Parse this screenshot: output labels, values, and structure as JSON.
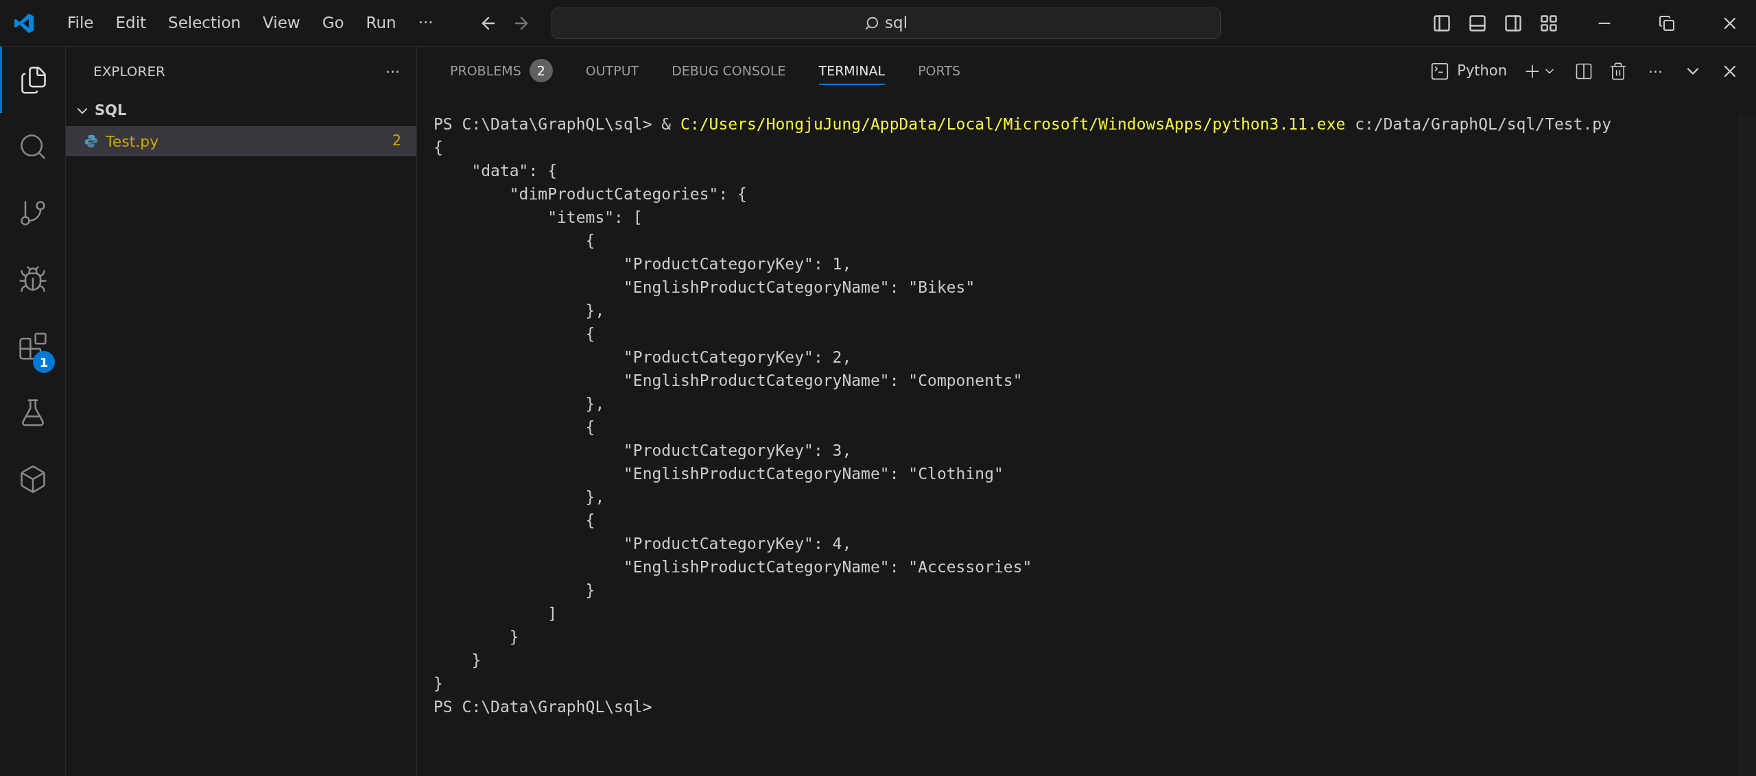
{
  "menu": [
    "File",
    "Edit",
    "Selection",
    "View",
    "Go",
    "Run",
    "···"
  ],
  "search": {
    "value": "sql"
  },
  "activity_bar": [
    {
      "kind": "explorer",
      "selected": true
    },
    {
      "kind": "search",
      "selected": false
    },
    {
      "kind": "source-control",
      "selected": false
    },
    {
      "kind": "run-debug",
      "selected": false
    },
    {
      "kind": "extensions",
      "selected": false,
      "badge": "1"
    },
    {
      "kind": "testing",
      "selected": false
    },
    {
      "kind": "cube",
      "selected": false
    }
  ],
  "sidebar": {
    "title": "EXPLORER",
    "more": "···",
    "folder": {
      "name": "SQL",
      "expanded": true,
      "children": [
        {
          "name": "Test.py",
          "badge": "2",
          "selected": true
        }
      ]
    }
  },
  "panel": {
    "tabs": [
      {
        "label": "PROBLEMS",
        "badge": "2",
        "selected": false
      },
      {
        "label": "OUTPUT",
        "selected": false
      },
      {
        "label": "DEBUG CONSOLE",
        "selected": false
      },
      {
        "label": "TERMINAL",
        "selected": true
      },
      {
        "label": "PORTS",
        "selected": false
      }
    ],
    "terminal_name": "Python",
    "more": "···",
    "lines": [
      [
        {
          "text": "PS C:\\Data\\GraphQL\\sql> & ",
          "kind": "plain"
        },
        {
          "text": "C:/Users/HongjuJung/AppData/Local/Microsoft/WindowsApps/python3.11.exe",
          "kind": "highlight"
        },
        {
          "text": " c:/Data/GraphQL/sql/Test.py",
          "kind": "plain"
        }
      ],
      [
        {
          "text": "{",
          "kind": "plain"
        }
      ],
      [
        {
          "text": "    \"data\": {",
          "kind": "plain"
        }
      ],
      [
        {
          "text": "        \"dimProductCategories\": {",
          "kind": "plain"
        }
      ],
      [
        {
          "text": "            \"items\": [",
          "kind": "plain"
        }
      ],
      [
        {
          "text": "                {",
          "kind": "plain"
        }
      ],
      [
        {
          "text": "                    \"ProductCategoryKey\": 1,",
          "kind": "plain"
        }
      ],
      [
        {
          "text": "                    \"EnglishProductCategoryName\": \"Bikes\"",
          "kind": "plain"
        }
      ],
      [
        {
          "text": "                },",
          "kind": "plain"
        }
      ],
      [
        {
          "text": "                {",
          "kind": "plain"
        }
      ],
      [
        {
          "text": "                    \"ProductCategoryKey\": 2,",
          "kind": "plain"
        }
      ],
      [
        {
          "text": "                    \"EnglishProductCategoryName\": \"Components\"",
          "kind": "plain"
        }
      ],
      [
        {
          "text": "                },",
          "kind": "plain"
        }
      ],
      [
        {
          "text": "                {",
          "kind": "plain"
        }
      ],
      [
        {
          "text": "                    \"ProductCategoryKey\": 3,",
          "kind": "plain"
        }
      ],
      [
        {
          "text": "                    \"EnglishProductCategoryName\": \"Clothing\"",
          "kind": "plain"
        }
      ],
      [
        {
          "text": "                },",
          "kind": "plain"
        }
      ],
      [
        {
          "text": "                {",
          "kind": "plain"
        }
      ],
      [
        {
          "text": "                    \"ProductCategoryKey\": 4,",
          "kind": "plain"
        }
      ],
      [
        {
          "text": "                    \"EnglishProductCategoryName\": \"Accessories\"",
          "kind": "plain"
        }
      ],
      [
        {
          "text": "                }",
          "kind": "plain"
        }
      ],
      [
        {
          "text": "            ]",
          "kind": "plain"
        }
      ],
      [
        {
          "text": "        }",
          "kind": "plain"
        }
      ],
      [
        {
          "text": "    }",
          "kind": "plain"
        }
      ],
      [
        {
          "text": "}",
          "kind": "plain"
        }
      ],
      [
        {
          "text": "PS C:\\Data\\GraphQL\\sql>",
          "kind": "plain"
        }
      ]
    ]
  }
}
